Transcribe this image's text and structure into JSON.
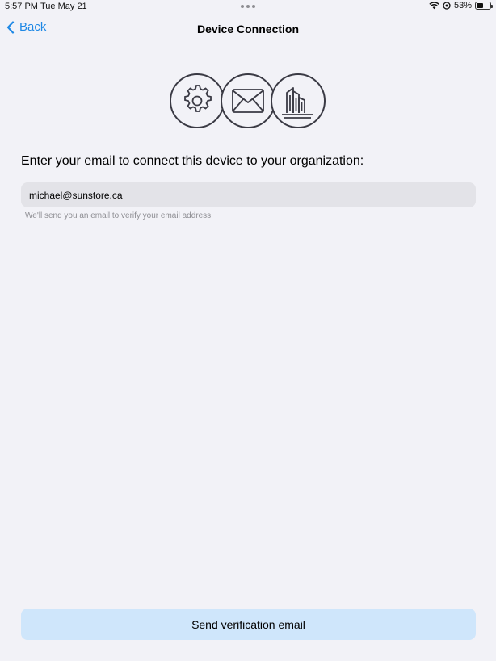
{
  "status_bar": {
    "time": "5:57 PM",
    "date": "Tue May 21",
    "battery": "53%",
    "battery_level": 0.53,
    "icons": [
      "wifi-icon",
      "location-icon",
      "battery-icon"
    ]
  },
  "nav": {
    "back_label": "Back",
    "title": "Device Connection"
  },
  "illustration": {
    "icons": [
      "gear-icon",
      "envelope-icon",
      "building-icon"
    ]
  },
  "form": {
    "prompt": "Enter your email to connect this device to your organization:",
    "email_value": "michael@sunstore.ca",
    "helper": "We'll send you an email to verify your email address."
  },
  "actions": {
    "send_label": "Send verification email"
  },
  "colors": {
    "background": "#f2f2f7",
    "accent": "#1e88e5",
    "button_bg": "#cfe6fb",
    "field_bg": "#e3e3e8"
  }
}
